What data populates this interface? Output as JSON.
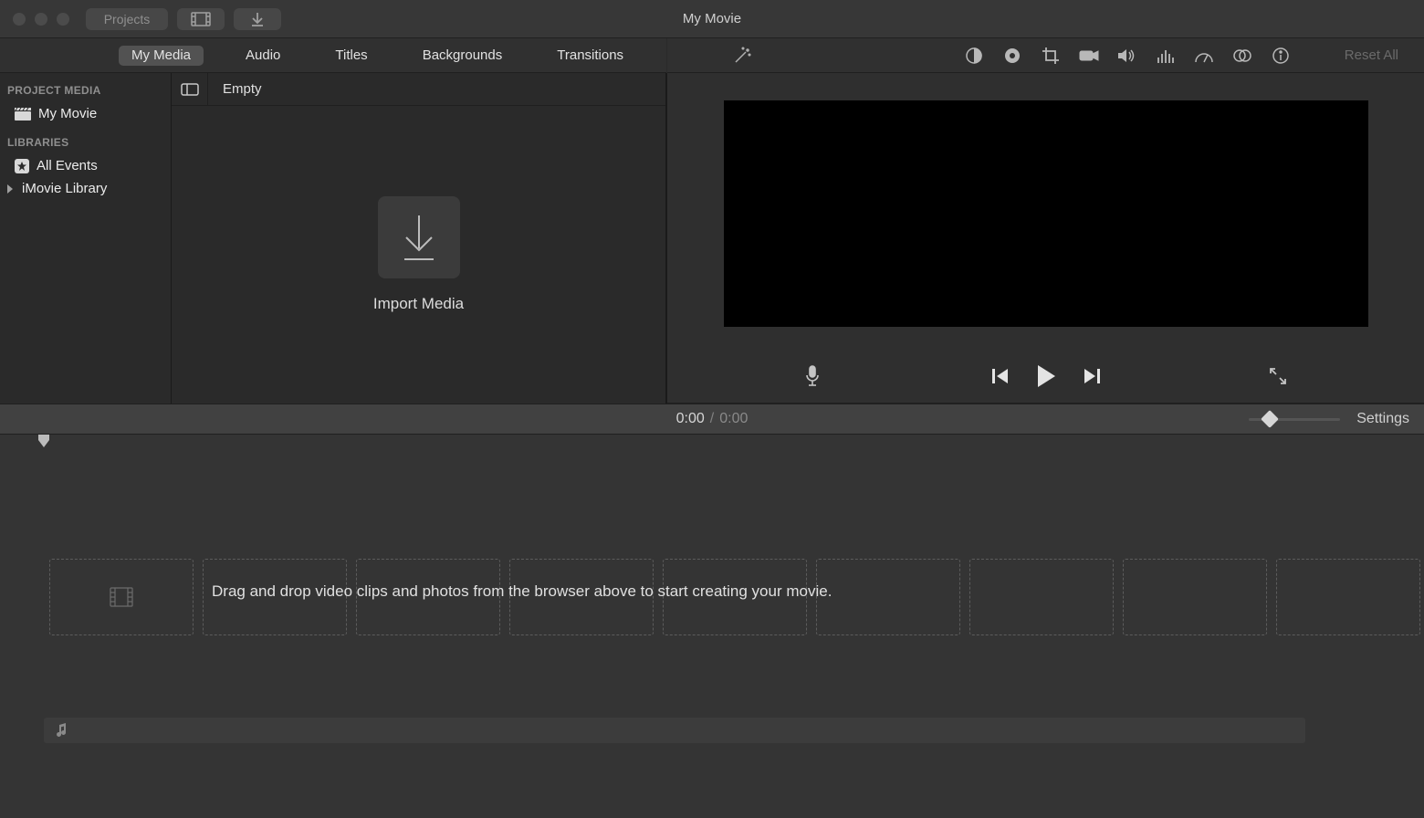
{
  "window": {
    "title": "My Movie",
    "projects_label": "Projects"
  },
  "browser_tabs": [
    "My Media",
    "Audio",
    "Titles",
    "Backgrounds",
    "Transitions"
  ],
  "browser_tabs_active": 0,
  "sidebar": {
    "project_media_header": "PROJECT MEDIA",
    "project": "My Movie",
    "libraries_header": "LIBRARIES",
    "all_events": "All Events",
    "library": "iMovie Library"
  },
  "browser": {
    "status": "Empty",
    "import_label": "Import Media"
  },
  "viewer": {
    "reset_label": "Reset All"
  },
  "playback": {
    "current": "0:00",
    "total": "0:00",
    "settings_label": "Settings"
  },
  "timeline": {
    "hint": "Drag and drop video clips and photos from the browser above to start creating your movie."
  },
  "icons": {
    "film": "film-icon",
    "download": "download-icon",
    "star": "star-icon",
    "wand": "wand-icon",
    "balance": "color-balance-icon",
    "colorwheel": "color-correction-icon",
    "crop": "crop-icon",
    "stabilize": "stabilization-icon",
    "volume": "volume-icon",
    "eq": "equalizer-icon",
    "speed": "speed-icon",
    "overlay": "overlay-icon",
    "info": "info-icon"
  }
}
